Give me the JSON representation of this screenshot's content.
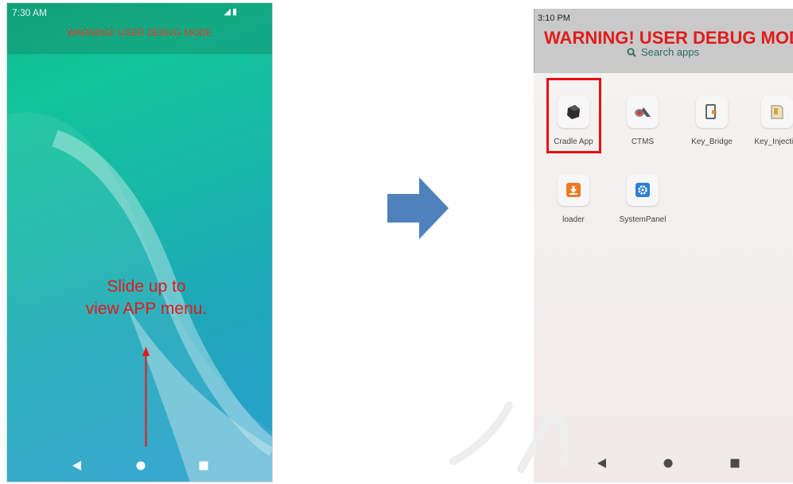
{
  "left_phone": {
    "time": "7:30 AM",
    "warning": "WARNING! USER DEBUG MODE",
    "hint_line1": "Slide up to",
    "hint_line2": "view APP menu.",
    "icons": [
      "signal-icon",
      "battery-icon"
    ],
    "nav": [
      "back-icon",
      "home-icon",
      "recents-icon"
    ]
  },
  "right_phone": {
    "time": "3:10 PM",
    "warning": "WARNING! USER DEBUG MODE",
    "search_label": "Search apps",
    "apps": [
      {
        "label": "Cradle App",
        "icon": "cradle-app-icon",
        "highlighted": true
      },
      {
        "label": "CTMS",
        "icon": "ctms-icon",
        "highlighted": false
      },
      {
        "label": "Key_Bridge",
        "icon": "key-bridge-icon",
        "highlighted": false
      },
      {
        "label": "Key_Injecti...",
        "icon": "key-injection-icon",
        "highlighted": false
      },
      {
        "label": "loader",
        "icon": "loader-icon",
        "highlighted": false
      },
      {
        "label": "SystemPanel",
        "icon": "system-panel-icon",
        "highlighted": false
      }
    ],
    "nav": [
      "back-icon",
      "home-icon",
      "recents-icon"
    ]
  },
  "colors": {
    "warning_red": "#e21b1b",
    "arrow_blue": "#4f81bd",
    "highlight_red": "#ea0e0e"
  }
}
